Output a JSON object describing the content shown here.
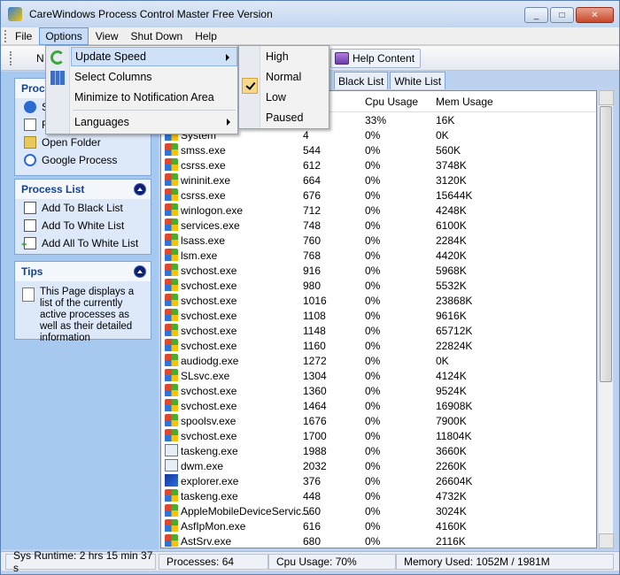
{
  "window": {
    "title": "CareWindows Process Control Master Free Version",
    "controls": [
      "_",
      "□",
      "✕"
    ]
  },
  "menubar": {
    "items": [
      "File",
      "Options",
      "View",
      "Shut Down",
      "Help"
    ]
  },
  "toolbar": {
    "first_label": "N",
    "help_label": "Help Content"
  },
  "options_menu": {
    "items": [
      "Update Speed",
      "Select Columns",
      "Minimize to Notification Area",
      "Languages"
    ]
  },
  "speed_submenu": {
    "items": [
      "High",
      "Normal",
      "Low",
      "Paused"
    ],
    "selected": "Normal"
  },
  "tabs": [
    "Black List",
    "White List"
  ],
  "left_panels": {
    "process": {
      "title": "Proc",
      "items": [
        "S",
        "F",
        "Open Folder",
        "Google Process"
      ]
    },
    "process_list": {
      "title": "Process List",
      "items": [
        "Add To Black List",
        "Add To White List",
        "Add All To White List"
      ]
    },
    "tips": {
      "title": "Tips",
      "text": "This Page displays a list of the currently active processes as well as their detailed information"
    }
  },
  "table": {
    "columns": [
      "Cpu Usage",
      "Mem Usage"
    ],
    "first_row": {
      "cpu": "33%",
      "mem": "16K"
    },
    "rows": [
      {
        "name": "System",
        "pid": "4",
        "cpu": "0%",
        "mem": "0K",
        "icon": "windows-icon"
      },
      {
        "name": "smss.exe",
        "pid": "544",
        "cpu": "0%",
        "mem": "560K",
        "icon": "windows-icon"
      },
      {
        "name": "csrss.exe",
        "pid": "612",
        "cpu": "0%",
        "mem": "3748K",
        "icon": "windows-icon"
      },
      {
        "name": "wininit.exe",
        "pid": "664",
        "cpu": "0%",
        "mem": "3120K",
        "icon": "windows-icon"
      },
      {
        "name": "csrss.exe",
        "pid": "676",
        "cpu": "0%",
        "mem": "15644K",
        "icon": "windows-icon"
      },
      {
        "name": "winlogon.exe",
        "pid": "712",
        "cpu": "0%",
        "mem": "4248K",
        "icon": "windows-icon"
      },
      {
        "name": "services.exe",
        "pid": "748",
        "cpu": "0%",
        "mem": "6100K",
        "icon": "windows-icon"
      },
      {
        "name": "lsass.exe",
        "pid": "760",
        "cpu": "0%",
        "mem": "2284K",
        "icon": "windows-icon"
      },
      {
        "name": "lsm.exe",
        "pid": "768",
        "cpu": "0%",
        "mem": "4420K",
        "icon": "windows-icon"
      },
      {
        "name": "svchost.exe",
        "pid": "916",
        "cpu": "0%",
        "mem": "5968K",
        "icon": "windows-icon"
      },
      {
        "name": "svchost.exe",
        "pid": "980",
        "cpu": "0%",
        "mem": "5532K",
        "icon": "windows-icon"
      },
      {
        "name": "svchost.exe",
        "pid": "1016",
        "cpu": "0%",
        "mem": "23868K",
        "icon": "windows-icon"
      },
      {
        "name": "svchost.exe",
        "pid": "1108",
        "cpu": "0%",
        "mem": "9616K",
        "icon": "windows-icon"
      },
      {
        "name": "svchost.exe",
        "pid": "1148",
        "cpu": "0%",
        "mem": "65712K",
        "icon": "windows-icon"
      },
      {
        "name": "svchost.exe",
        "pid": "1160",
        "cpu": "0%",
        "mem": "22824K",
        "icon": "windows-icon"
      },
      {
        "name": "audiodg.exe",
        "pid": "1272",
        "cpu": "0%",
        "mem": "0K",
        "icon": "windows-icon"
      },
      {
        "name": "SLsvc.exe",
        "pid": "1304",
        "cpu": "0%",
        "mem": "4124K",
        "icon": "windows-icon"
      },
      {
        "name": "svchost.exe",
        "pid": "1360",
        "cpu": "0%",
        "mem": "9524K",
        "icon": "windows-icon"
      },
      {
        "name": "svchost.exe",
        "pid": "1464",
        "cpu": "0%",
        "mem": "16908K",
        "icon": "windows-icon"
      },
      {
        "name": "spoolsv.exe",
        "pid": "1676",
        "cpu": "0%",
        "mem": "7900K",
        "icon": "windows-icon"
      },
      {
        "name": "svchost.exe",
        "pid": "1700",
        "cpu": "0%",
        "mem": "11804K",
        "icon": "windows-icon"
      },
      {
        "name": "taskeng.exe",
        "pid": "1988",
        "cpu": "0%",
        "mem": "3660K",
        "icon": "app-icon"
      },
      {
        "name": "dwm.exe",
        "pid": "2032",
        "cpu": "0%",
        "mem": "2260K",
        "icon": "app-icon"
      },
      {
        "name": "explorer.exe",
        "pid": "376",
        "cpu": "0%",
        "mem": "26604K",
        "icon": "explorer-icon"
      },
      {
        "name": "taskeng.exe",
        "pid": "448",
        "cpu": "0%",
        "mem": "4732K",
        "icon": "windows-icon"
      },
      {
        "name": "AppleMobileDeviceServic...",
        "pid": "560",
        "cpu": "0%",
        "mem": "3024K",
        "icon": "windows-icon"
      },
      {
        "name": "AsfIpMon.exe",
        "pid": "616",
        "cpu": "0%",
        "mem": "4160K",
        "icon": "windows-icon"
      },
      {
        "name": "AstSrv.exe",
        "pid": "680",
        "cpu": "0%",
        "mem": "2116K",
        "icon": "windows-icon"
      }
    ]
  },
  "statusbar": {
    "runtime": "Sys Runtime: 2 hrs 15 min 37 s",
    "processes": "Processes: 64",
    "cpu": "Cpu Usage: 70%",
    "memory": "Memory Used: 1052M / 1981M"
  }
}
